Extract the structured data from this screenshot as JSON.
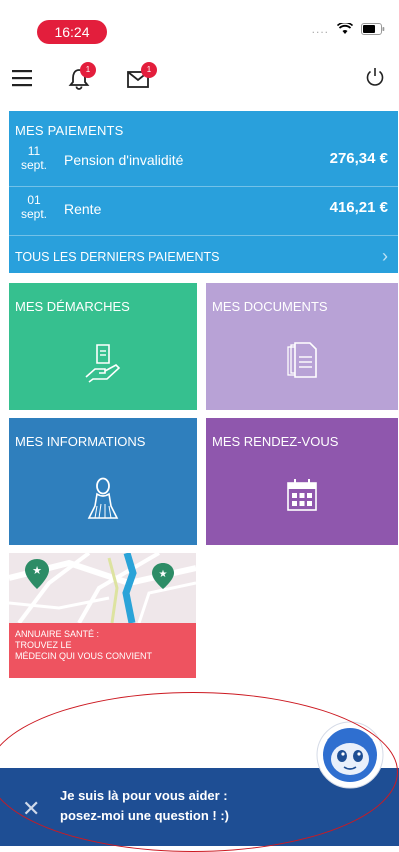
{
  "status_bar": {
    "time": "16:24",
    "signal": "....",
    "time_bg": "#e31e3c"
  },
  "topnav": {
    "menu_icon": "hamburger-menu-icon",
    "notifications_icon": "bell-icon",
    "notifications_badge": "1",
    "messages_icon": "envelope-icon",
    "messages_badge": "1",
    "power_icon": "power-icon"
  },
  "payments": {
    "title": "MES PAIEMENTS",
    "color": "#29a0dc",
    "rows": [
      {
        "day": "11",
        "month": "sept.",
        "label": "Pension d'invalidité",
        "amount": "276,34 €"
      },
      {
        "day": "01",
        "month": "sept.",
        "label": "Rente",
        "amount": "416,21 €"
      }
    ],
    "all_link": "TOUS LES DERNIERS PAIEMENTS"
  },
  "tiles": [
    {
      "label": "MES DÉMARCHES",
      "color": "#36c08f",
      "icon": "hand-document-icon"
    },
    {
      "label": "MES DOCUMENTS",
      "color": "#b8a2d6",
      "icon": "documents-icon"
    },
    {
      "label": "MES INFORMATIONS",
      "color": "#2f7fbd",
      "icon": "person-silhouette-icon"
    },
    {
      "label": "MES RENDEZ-VOUS",
      "color": "#8f57ad",
      "icon": "calendar-icon"
    }
  ],
  "annuaire": {
    "line1": "ANNUAIRE SANTÉ :",
    "line2": "TROUVEZ LE",
    "line3": "MÉDECIN QUI VOUS CONVIENT",
    "color": "#ee5360"
  },
  "chatbot": {
    "line1": "Je suis là pour vous aider :",
    "line2": "posez-moi une question ! :)",
    "color": "#1e4e94",
    "close_icon": "close-icon",
    "avatar_icon": "robot-assistant-icon"
  }
}
